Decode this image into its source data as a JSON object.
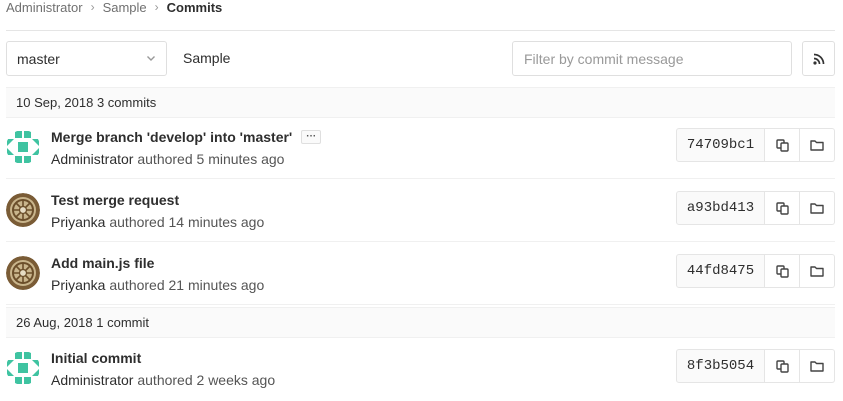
{
  "breadcrumb": {
    "items": [
      "Administrator",
      "Sample"
    ],
    "separator": "›",
    "current": "Commits"
  },
  "toolbar": {
    "branch": "master",
    "project": "Sample",
    "filter_placeholder": "Filter by commit message",
    "rss_icon": "rss-icon"
  },
  "days": [
    {
      "label": "10 Sep, 2018 3 commits",
      "commits": [
        {
          "title": "Merge branch 'develop' into 'master'",
          "has_ellipsis": true,
          "ellipsis": "···",
          "author": "Administrator",
          "authored": "authored 5 minutes ago",
          "sha": "74709bc1",
          "avatar": "identicon-green"
        },
        {
          "title": "Test merge request",
          "has_ellipsis": false,
          "author": "Priyanka",
          "authored": "authored 14 minutes ago",
          "sha": "a93bd413",
          "avatar": "photo-avatar"
        },
        {
          "title": "Add main.js file",
          "has_ellipsis": false,
          "author": "Priyanka",
          "authored": "authored 21 minutes ago",
          "sha": "44fd8475",
          "avatar": "photo-avatar"
        }
      ]
    },
    {
      "label": "26 Aug, 2018 1 commit",
      "commits": [
        {
          "title": "Initial commit",
          "has_ellipsis": false,
          "author": "Administrator",
          "authored": "authored 2 weeks ago",
          "sha": "8f3b5054",
          "avatar": "identicon-green"
        }
      ]
    }
  ],
  "colors": {
    "identicon": "#3fc3a1",
    "photo": "#8b6a3e"
  }
}
